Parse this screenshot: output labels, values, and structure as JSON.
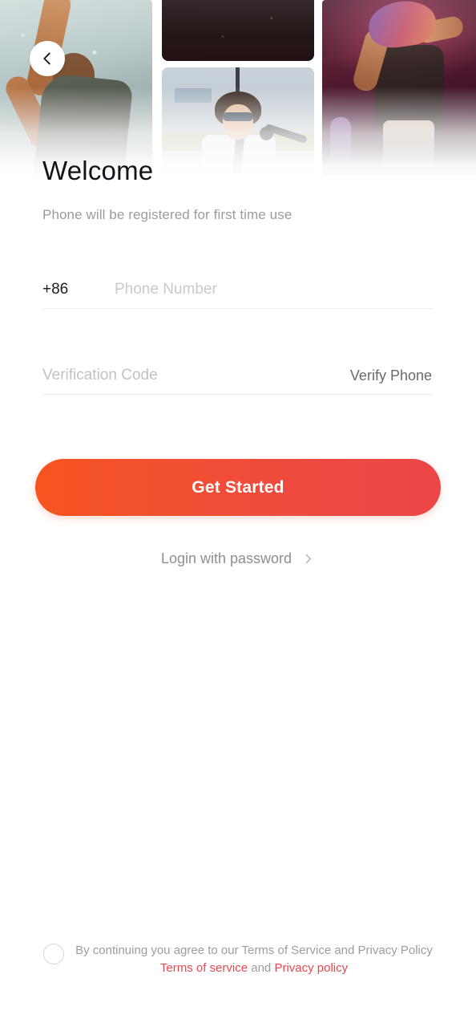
{
  "header": {
    "back_icon": "chevron-left-icon",
    "images": [
      {
        "name": "stage-performer-smoke-photo"
      },
      {
        "name": "dark-concert-photo"
      },
      {
        "name": "daylight-singer-sunglasses-photo"
      },
      {
        "name": "purple-stage-performer-photo"
      }
    ]
  },
  "page": {
    "title": "Welcome",
    "subtitle": "Phone will be registered for first time use"
  },
  "form": {
    "country_code": "+86",
    "phone_value": "",
    "phone_placeholder": "Phone Number",
    "code_value": "",
    "code_placeholder": "Verification Code",
    "verify_label": "Verify Phone"
  },
  "actions": {
    "primary_label": "Get Started",
    "alt_login_label": "Login with password",
    "alt_login_icon": "chevron-right-icon"
  },
  "footer": {
    "agree_checked": false,
    "notice": "By continuing you agree to our Terms of Service and Privacy Policy",
    "terms_link": "Terms of service",
    "conjunction": "and",
    "privacy_link": "Privacy policy"
  },
  "colors": {
    "cta_gradient_start": "#F7551F",
    "cta_gradient_end": "#EC4547",
    "link_red": "#E8484C",
    "title_dark": "#111418",
    "muted_gray": "#9b9b9b",
    "placeholder_gray": "#c9c9c9",
    "divider": "#eeeeee"
  }
}
